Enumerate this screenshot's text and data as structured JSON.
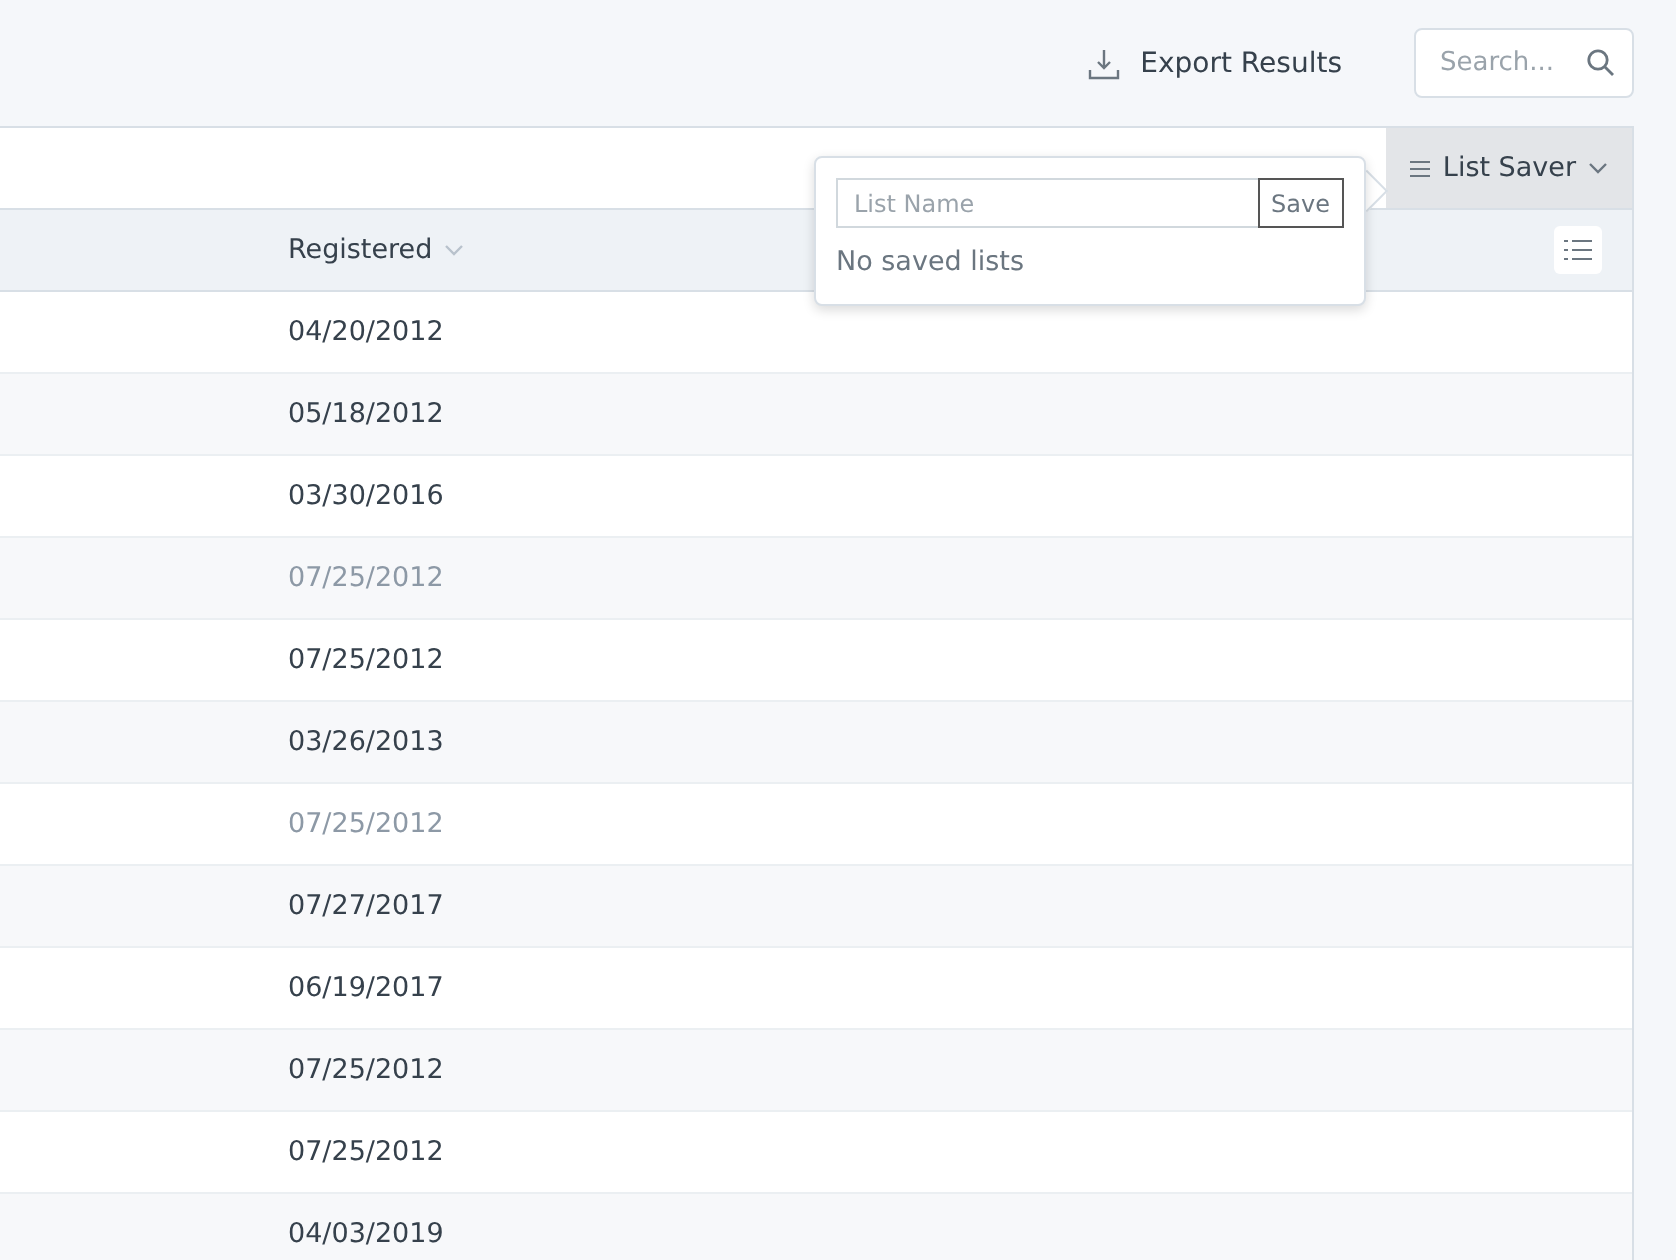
{
  "top_bar": {
    "export_button": "Export Results",
    "search": {
      "placeholder": "Search..."
    }
  },
  "list_saver": {
    "label": "List Saver",
    "expanded": true
  },
  "popover": {
    "name_field": {
      "placeholder": "List Name"
    },
    "save_button": "Save",
    "empty_message": "No saved lists"
  },
  "table": {
    "columns": [
      {
        "label": "Registered"
      }
    ],
    "rows": [
      {
        "registered": "04/20/2012",
        "muted": false
      },
      {
        "registered": "05/18/2012",
        "muted": false
      },
      {
        "registered": "03/30/2016",
        "muted": false
      },
      {
        "registered": "07/25/2012",
        "muted": true
      },
      {
        "registered": "07/25/2012",
        "muted": false
      },
      {
        "registered": "03/26/2013",
        "muted": false
      },
      {
        "registered": "07/25/2012",
        "muted": true
      },
      {
        "registered": "07/27/2017",
        "muted": false
      },
      {
        "registered": "06/19/2017",
        "muted": false
      },
      {
        "registered": "07/25/2012",
        "muted": false
      },
      {
        "registered": "07/25/2012",
        "muted": false
      },
      {
        "registered": "04/03/2019",
        "muted": false
      }
    ]
  }
}
